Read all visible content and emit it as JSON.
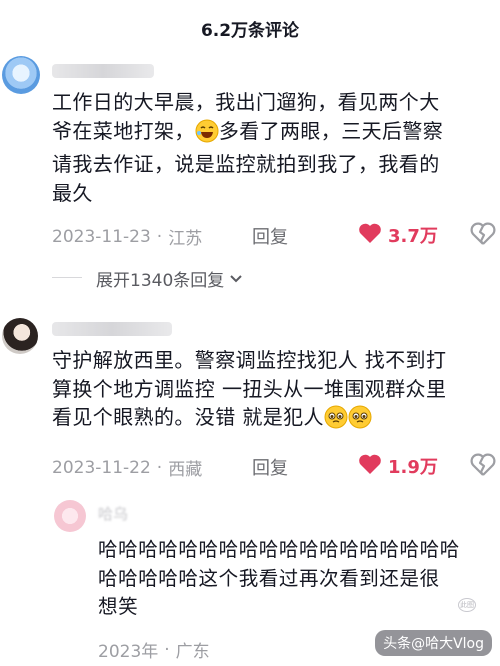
{
  "header": {
    "title": "6.2万条评论"
  },
  "comments": [
    {
      "text": "工作日的大早晨，我出门遛狗，看见两个大\n爷在菜地打架，",
      "text_after_emoji": "多看了两眼，三天后警察\n请我去作证，说是监控就拍到我了，我看的\n最久",
      "date": "2023-11-23",
      "location": "江苏",
      "reply_label": "回复",
      "likes": "3.7万"
    },
    {
      "text": "守护解放西里。警察调监控找犯人 找不到打\n算换个地方调监控 一扭头从一堆围观群众里\n看见个眼熟的。没错 就是犯人",
      "date": "2023-11-22",
      "location": "西藏",
      "reply_label": "回复",
      "likes": "1.9万"
    }
  ],
  "expand": {
    "label": "展开1340条回复"
  },
  "reply": {
    "name": "哈乌",
    "text": "哈哈哈哈哈哈哈哈哈哈哈哈哈哈哈哈哈哈\n哈哈哈哈哈这个我看过再次看到还是很\n想笑",
    "date": "2023年",
    "location": "广东"
  },
  "watermark": {
    "text": "头条@哈大Vlog",
    "logo": "此图"
  },
  "colors": {
    "like": "#e13b5d",
    "meta": "#9d9ea3",
    "text": "#161823"
  },
  "icons": {
    "like": "heart-filled-icon",
    "dislike": "broken-heart-icon",
    "expand": "chevron-down-icon"
  }
}
